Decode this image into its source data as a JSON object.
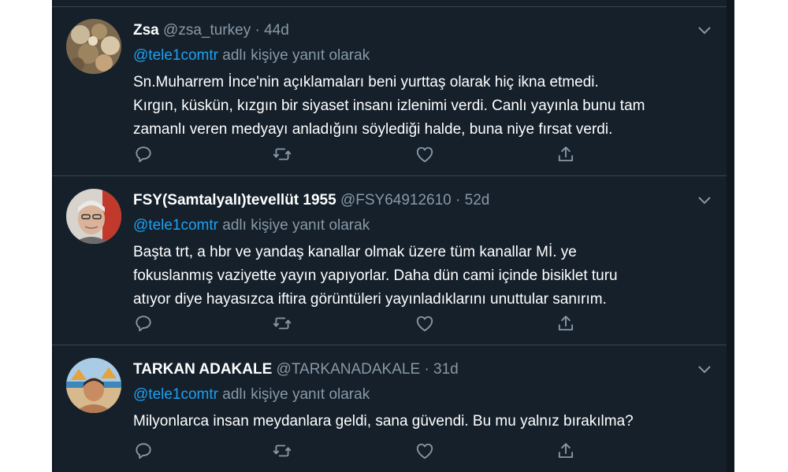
{
  "tweets": [
    {
      "name": "Zsa",
      "handle": "@zsa_turkey",
      "separator": "·",
      "age": "44d",
      "reply_mention": "@tele1comtr",
      "reply_suffix": " adlı kişiye yanıt olarak",
      "lines": [
        "Sn.Muharrem İnce'nin açıklamaları beni  yurttaş olarak hiç ikna etmedi.",
        "Kırgın, küskün,  kızgın bir siyaset insanı izlenimi verdi. Canlı yayınla bunu tam",
        "zamanlı veren medyayı anladığını söylediği halde, buna niye fırsat verdi."
      ]
    },
    {
      "name": "FSY(Samtalyalı)tevellüt 1955",
      "handle": "@FSY64912610",
      "separator": "·",
      "age": "52d",
      "reply_mention": "@tele1comtr",
      "reply_suffix": " adlı kişiye yanıt olarak",
      "lines": [
        "Başta trt, a hbr ve yandaş kanallar olmak üzere tüm kanallar Mİ. ye",
        "fokuslanmış vaziyette yayın yapıyorlar. Daha dün cami içinde bisiklet turu",
        "atıyor diye hayasızca iftira görüntüleri yayınladıklarını unuttular sanırım."
      ]
    },
    {
      "name": "TARKAN ADAKALE",
      "handle": "@TARKANADAKALE",
      "separator": "·",
      "age": "31d",
      "reply_mention": "@tele1comtr",
      "reply_suffix": " adlı kişiye yanıt olarak",
      "lines": [
        "Milyonlarca insan meydanlara geldi, sana güvendi. Bu mu yalnız bırakılma?"
      ]
    }
  ],
  "icons": {
    "reply": "reply-icon",
    "retweet": "retweet-icon",
    "like": "heart-icon",
    "share": "share-icon",
    "menu": "chevron-down-icon"
  },
  "colors": {
    "background": "#15202b",
    "accent": "#1da1f2",
    "muted": "#8899a6",
    "text": "#ffffff",
    "divider": "#38444d"
  }
}
